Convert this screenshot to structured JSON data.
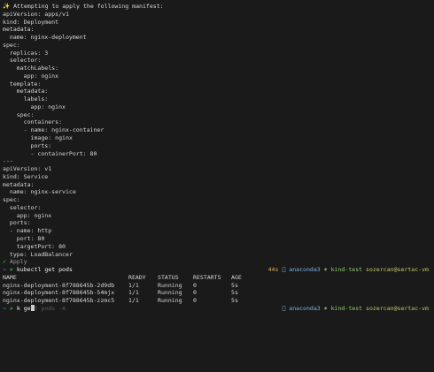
{
  "header": {
    "icon": "sparkles",
    "text": "Attempting to apply the following manifest:"
  },
  "manifest_lines": [
    "apiVersion: apps/v1",
    "kind: Deployment",
    "metadata:",
    "  name: nginx-deployment",
    "spec:",
    "  replicas: 3",
    "  selector:",
    "    matchLabels:",
    "      app: nginx",
    "  template:",
    "    metadata:",
    "      labels:",
    "        app: nginx",
    "    spec:",
    "      containers:",
    "      - name: nginx-container",
    "        image: nginx",
    "        ports:",
    "        - containerPort: 80",
    "---",
    "apiVersion: v1",
    "kind: Service",
    "metadata:",
    "  name: nginx-service",
    "spec:",
    "  selector:",
    "    app: nginx",
    "  ports:",
    "  - name: http",
    "    port: 80",
    "    targetPort: 80",
    "  type: LoadBalancer"
  ],
  "apply": {
    "check": "✓",
    "label": "Apply"
  },
  "prompt1": {
    "tilde": "~",
    "arrow": ">",
    "command": "kubectl get pods",
    "duration": "44s",
    "env_icon": "",
    "env": "anaconda3",
    "ctx_icon": "⎈",
    "context": "kind-test",
    "user": "sozercan@sertac-vm"
  },
  "pods": {
    "columns": [
      "NAME",
      "READY",
      "STATUS",
      "RESTARTS",
      "AGE"
    ],
    "rows": [
      [
        "nginx-deployment-8f788645b-2d9db",
        "1/1",
        "Running",
        "0",
        "5s"
      ],
      [
        "nginx-deployment-8f788645b-54mjx",
        "1/1",
        "Running",
        "0",
        "5s"
      ],
      [
        "nginx-deployment-8f788645b-zzmc5",
        "1/1",
        "Running",
        "0",
        "5s"
      ]
    ]
  },
  "prompt2": {
    "tilde": "~",
    "arrow": ">",
    "typed": "k ge",
    "suggestion": "t pods -A",
    "env_icon": "",
    "env": "anaconda3",
    "ctx_icon": "⎈",
    "context": "kind-test",
    "user": "sozercan@sertac-vm"
  },
  "colors": {
    "background": "#1a1a1a",
    "text": "#d6d6d6",
    "success": "#5fd35f",
    "highlight": "#f5d442"
  }
}
